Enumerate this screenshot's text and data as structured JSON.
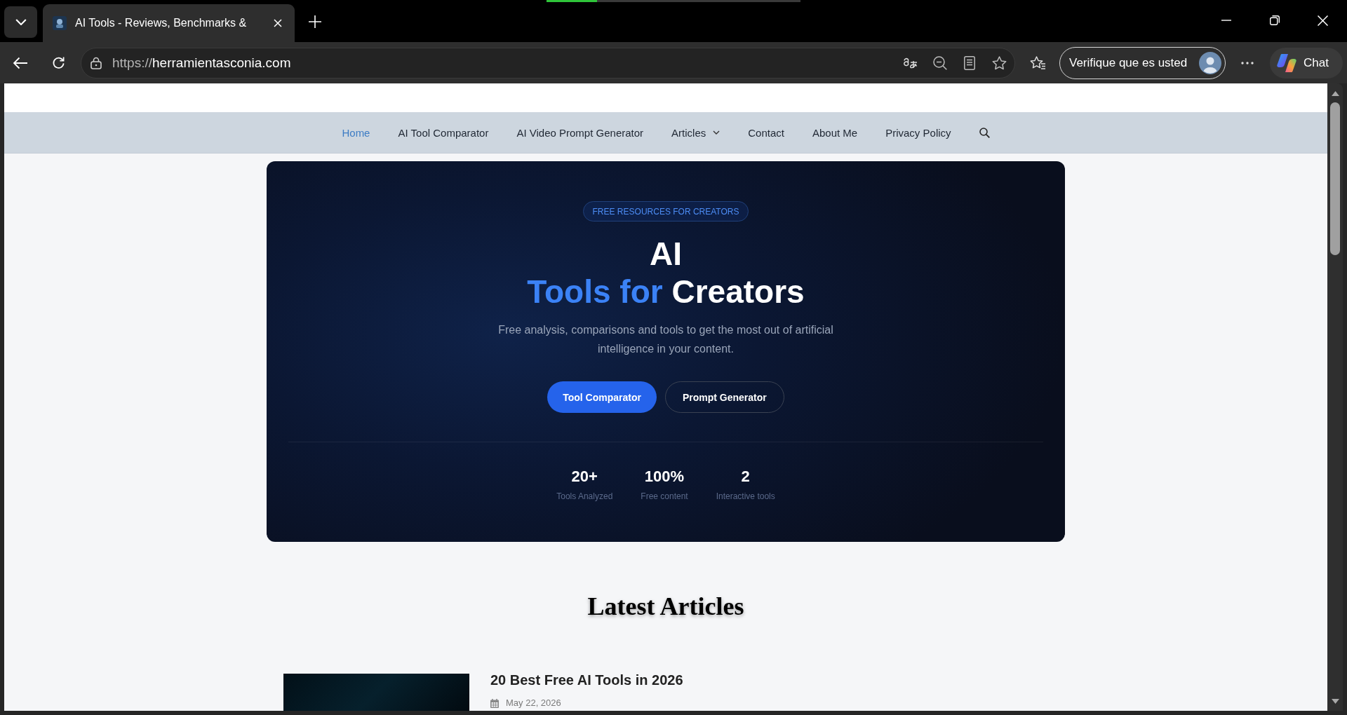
{
  "browser": {
    "tabs": [
      {
        "title": "AI Tools - Reviews, Benchmarks &",
        "selected": true
      }
    ],
    "indicator_bar": {
      "level": 0.2
    },
    "address": {
      "scheme": "https://",
      "host": "herramientasconia.com"
    },
    "profile": {
      "label": "Verifique que es usted"
    },
    "chat_button": {
      "label": "Chat"
    }
  },
  "site": {
    "nav": [
      {
        "label": "Home",
        "selected": true,
        "has_submenu": false
      },
      {
        "label": "AI Tool Comparator",
        "selected": false,
        "has_submenu": false
      },
      {
        "label": "AI Video Prompt Generator",
        "selected": false,
        "has_submenu": false
      },
      {
        "label": "Articles",
        "selected": false,
        "has_submenu": true
      },
      {
        "label": "Contact",
        "selected": false,
        "has_submenu": false
      },
      {
        "label": "About Me",
        "selected": false,
        "has_submenu": false
      },
      {
        "label": "Privacy Policy",
        "selected": false,
        "has_submenu": false
      }
    ],
    "hero": {
      "badge": "FREE RESOURCES FOR CREATORS",
      "title": {
        "line_1": "AI",
        "highlight": "Tools for",
        "rest": "Creators"
      },
      "subtitle": "Free analysis, comparisons and tools to get the most out of artificial intelligence in your content.",
      "buttons": [
        {
          "label": "Tool Comparator",
          "kind": "primary"
        },
        {
          "label": "Prompt Generator",
          "kind": "outline"
        }
      ],
      "stats": [
        {
          "value": "20+",
          "label": "Tools Analyzed"
        },
        {
          "value": "100%",
          "label": "Free content"
        },
        {
          "value": "2",
          "label": "Interactive tools"
        }
      ]
    },
    "latest": {
      "heading": "Latest Articles",
      "articles": [
        {
          "title": "20 Best Free AI Tools in 2026",
          "date": "May 22, 2026"
        }
      ]
    }
  }
}
